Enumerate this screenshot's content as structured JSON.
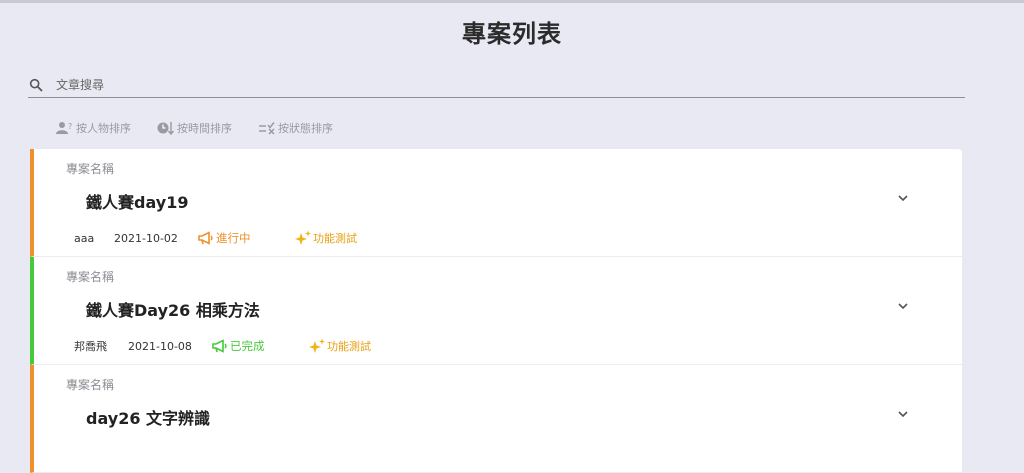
{
  "header": {
    "title": "專案列表"
  },
  "search": {
    "placeholder": "文章搜尋",
    "value": ""
  },
  "sort": [
    {
      "label": "按人物排序",
      "icon": "person-question-icon"
    },
    {
      "label": "按時間排序",
      "icon": "clock-down-icon"
    },
    {
      "label": "按狀態排序",
      "icon": "list-check-icon"
    }
  ],
  "projects": [
    {
      "field_label": "專案名稱",
      "title": "鐵人賽day19",
      "author": "aaa",
      "date": "2021-10-02",
      "status": "進行中",
      "status_color": "#f0902c",
      "tag": "功能測試",
      "tag_color": "#e6a011"
    },
    {
      "field_label": "專案名稱",
      "title": "鐵人賽Day26 相乘方法",
      "author": "邦喬飛",
      "date": "2021-10-08",
      "status": "已完成",
      "status_color": "#46c93a",
      "tag": "功能測試",
      "tag_color": "#e6a011"
    },
    {
      "field_label": "專案名稱",
      "title": "day26 文字辨識"
    }
  ],
  "colors": {
    "background": "#e9e9f4",
    "in_progress": "#f0902c",
    "completed": "#46c93a",
    "tag": "#e6a011"
  }
}
